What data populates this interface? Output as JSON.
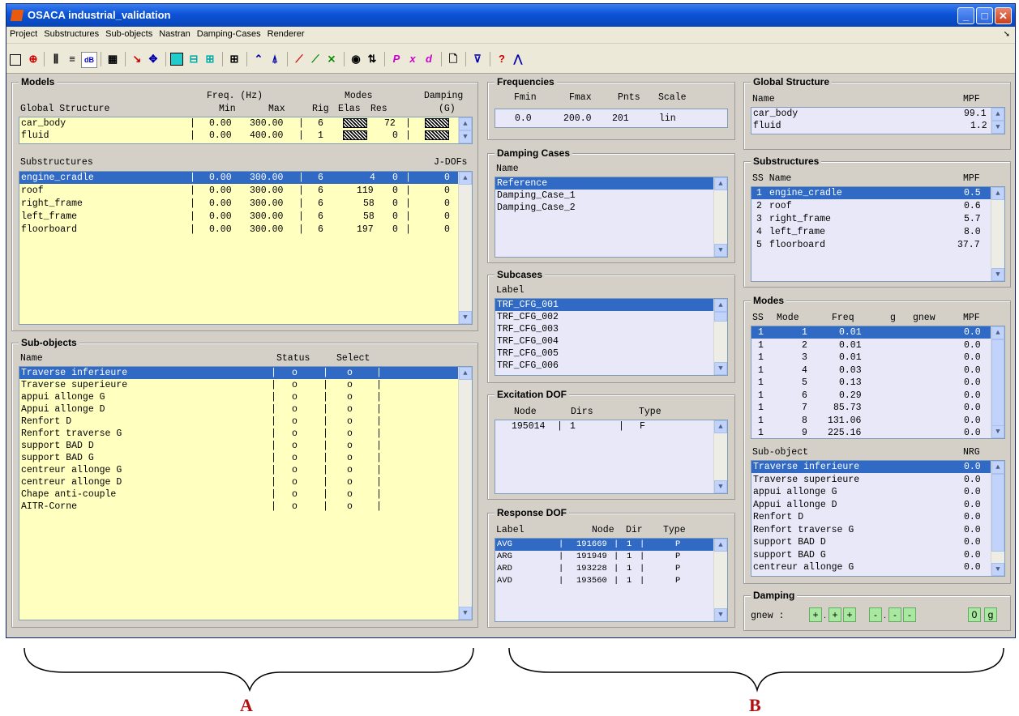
{
  "window": {
    "title": "OSACA industrial_validation"
  },
  "menu": [
    "Project",
    "Substructures",
    "Sub-objects",
    "Nastran",
    "Damping-Cases",
    "Renderer"
  ],
  "models": {
    "title": "Models",
    "h1": {
      "freq": "Freq. (Hz)",
      "modes": "Modes",
      "damping": "Damping"
    },
    "h2": {
      "name": "Global Structure",
      "min": "Min",
      "max": "Max",
      "rig": "Rig",
      "elas": "Elas",
      "res": "Res",
      "g": "(G)"
    },
    "global_rows": [
      {
        "name": "car_body",
        "min": "0.00",
        "max": "300.00",
        "rig": "6",
        "res": "72"
      },
      {
        "name": "fluid",
        "min": "0.00",
        "max": "400.00",
        "rig": "1",
        "res": "0"
      }
    ],
    "sub_label": "Substructures",
    "jdofs_label": "J-DOFs",
    "sub_rows": [
      {
        "name": "engine_cradle",
        "min": "0.00",
        "max": "300.00",
        "rig": "6",
        "elas": "4",
        "res": "0",
        "j": "0"
      },
      {
        "name": "roof",
        "min": "0.00",
        "max": "300.00",
        "rig": "6",
        "elas": "119",
        "res": "0",
        "j": "0"
      },
      {
        "name": "right_frame",
        "min": "0.00",
        "max": "300.00",
        "rig": "6",
        "elas": "58",
        "res": "0",
        "j": "0"
      },
      {
        "name": "left_frame",
        "min": "0.00",
        "max": "300.00",
        "rig": "6",
        "elas": "58",
        "res": "0",
        "j": "0"
      },
      {
        "name": "floorboard",
        "min": "0.00",
        "max": "300.00",
        "rig": "6",
        "elas": "197",
        "res": "0",
        "j": "0"
      }
    ]
  },
  "subobjects": {
    "title": "Sub-objects",
    "h": {
      "name": "Name",
      "status": "Status",
      "select": "Select"
    },
    "rows": [
      {
        "name": "Traverse inferieure",
        "status": "o",
        "select": "o"
      },
      {
        "name": "Traverse superieure",
        "status": "o",
        "select": "o"
      },
      {
        "name": "appui allonge G",
        "status": "o",
        "select": "o"
      },
      {
        "name": "Appui allonge D",
        "status": "o",
        "select": "o"
      },
      {
        "name": "Renfort D",
        "status": "o",
        "select": "o"
      },
      {
        "name": "Renfort traverse G",
        "status": "o",
        "select": "o"
      },
      {
        "name": "support BAD D",
        "status": "o",
        "select": "o"
      },
      {
        "name": "support BAD G",
        "status": "o",
        "select": "o"
      },
      {
        "name": "centreur allonge G",
        "status": "o",
        "select": "o"
      },
      {
        "name": "centreur allonge D",
        "status": "o",
        "select": "o"
      },
      {
        "name": "Chape anti-couple",
        "status": "o",
        "select": "o"
      },
      {
        "name": "AITR-Corne",
        "status": "o",
        "select": "o"
      }
    ]
  },
  "frequencies": {
    "title": "Frequencies",
    "h": {
      "fmin": "Fmin",
      "fmax": "Fmax",
      "pnts": "Pnts",
      "scale": "Scale"
    },
    "v": {
      "fmin": "0.0",
      "fmax": "200.0",
      "pnts": "201",
      "scale": "lin"
    }
  },
  "damping_cases": {
    "title": "Damping Cases",
    "h": "Name",
    "rows": [
      "Reference",
      "Damping_Case_1",
      "Damping_Case_2"
    ]
  },
  "subcases": {
    "title": "Subcases",
    "h": "Label",
    "rows": [
      "TRF_CFG_001",
      "TRF_CFG_002",
      "TRF_CFG_003",
      "TRF_CFG_004",
      "TRF_CFG_005",
      "TRF_CFG_006"
    ]
  },
  "excitation": {
    "title": "Excitation DOF",
    "h": {
      "node": "Node",
      "dirs": "Dirs",
      "type": "Type"
    },
    "rows": [
      {
        "node": "195014",
        "dirs": "1",
        "type": "F"
      }
    ]
  },
  "response": {
    "title": "Response DOF",
    "h": {
      "label": "Label",
      "node": "Node",
      "dir": "Dir",
      "type": "Type"
    },
    "rows": [
      {
        "label": "AVG",
        "node": "191669",
        "dir": "1",
        "type": "P"
      },
      {
        "label": "ARG",
        "node": "191949",
        "dir": "1",
        "type": "P"
      },
      {
        "label": "ARD",
        "node": "193228",
        "dir": "1",
        "type": "P"
      },
      {
        "label": "AVD",
        "node": "193560",
        "dir": "1",
        "type": "P"
      }
    ]
  },
  "global_structure": {
    "title": "Global Structure",
    "h": {
      "name": "Name",
      "mpf": "MPF"
    },
    "rows": [
      {
        "name": "car_body",
        "mpf": "99.1"
      },
      {
        "name": "fluid",
        "mpf": "1.2"
      }
    ]
  },
  "substructures": {
    "title": "Substructures",
    "h": {
      "ss": "SS Name",
      "mpf": "MPF"
    },
    "rows": [
      {
        "n": "1",
        "name": "engine_cradle",
        "mpf": "0.5"
      },
      {
        "n": "2",
        "name": "roof",
        "mpf": "0.6"
      },
      {
        "n": "3",
        "name": "right_frame",
        "mpf": "5.7"
      },
      {
        "n": "4",
        "name": "left_frame",
        "mpf": "8.0"
      },
      {
        "n": "5",
        "name": "floorboard",
        "mpf": "37.7"
      }
    ]
  },
  "modes": {
    "title": "Modes",
    "h": {
      "ss": "SS",
      "mode": "Mode",
      "freq": "Freq",
      "g": "g",
      "gnew": "gnew",
      "mpf": "MPF"
    },
    "rows": [
      {
        "ss": "1",
        "mode": "1",
        "freq": "0.01",
        "mpf": "0.0"
      },
      {
        "ss": "1",
        "mode": "2",
        "freq": "0.01",
        "mpf": "0.0"
      },
      {
        "ss": "1",
        "mode": "3",
        "freq": "0.01",
        "mpf": "0.0"
      },
      {
        "ss": "1",
        "mode": "4",
        "freq": "0.03",
        "mpf": "0.0"
      },
      {
        "ss": "1",
        "mode": "5",
        "freq": "0.13",
        "mpf": "0.0"
      },
      {
        "ss": "1",
        "mode": "6",
        "freq": "0.29",
        "mpf": "0.0"
      },
      {
        "ss": "1",
        "mode": "7",
        "freq": "85.73",
        "mpf": "0.0"
      },
      {
        "ss": "1",
        "mode": "8",
        "freq": "131.06",
        "mpf": "0.0"
      },
      {
        "ss": "1",
        "mode": "9",
        "freq": "225.16",
        "mpf": "0.0"
      }
    ],
    "nrg_h": {
      "name": "Sub-object",
      "nrg": "NRG"
    },
    "nrg_rows": [
      {
        "name": "Traverse inferieure",
        "v": "0.0"
      },
      {
        "name": "Traverse superieure",
        "v": "0.0"
      },
      {
        "name": "appui allonge G",
        "v": "0.0"
      },
      {
        "name": "Appui allonge D",
        "v": "0.0"
      },
      {
        "name": "Renfort D",
        "v": "0.0"
      },
      {
        "name": "Renfort traverse G",
        "v": "0.0"
      },
      {
        "name": "support BAD D",
        "v": "0.0"
      },
      {
        "name": "support BAD G",
        "v": "0.0"
      },
      {
        "name": "centreur allonge G",
        "v": "0.0"
      }
    ]
  },
  "damping": {
    "title": "Damping",
    "label": "gnew :",
    "buttons": [
      "+",
      "+",
      "+",
      "-",
      "-",
      "-",
      "0",
      "g"
    ]
  },
  "annotations": {
    "a": "A",
    "b": "B"
  }
}
